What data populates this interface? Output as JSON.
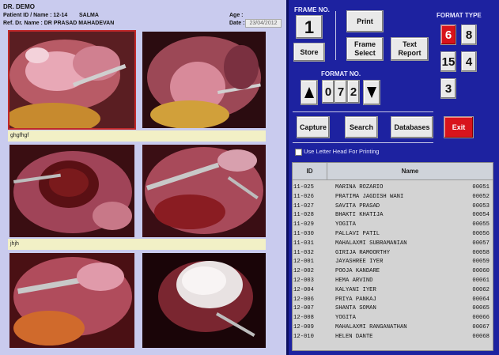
{
  "report": {
    "doctor": "DR. DEMO",
    "patient_label": "Patient ID / Name : 12-14",
    "patient_name": "SALMA",
    "ref_label": "Ref. Dr. Name : DR PRASAD MAHADEVAN",
    "age_label": "Age :",
    "date_label": "Date :",
    "date_value": "23/04/2012",
    "captions": [
      "ghgfhgf",
      "jhjh"
    ]
  },
  "controls": {
    "frame_no_label": "FRAME NO.",
    "frame_no": "1",
    "store": "Store",
    "print": "Print",
    "frame_select": "Frame Select",
    "text_report": "Text Report",
    "format_no_label": "FORMAT  NO.",
    "format_digits": [
      "0",
      "7",
      "2"
    ],
    "format_type_label": "FORMAT  TYPE",
    "format_types": [
      "6",
      "8",
      "15",
      "4",
      "3"
    ],
    "capture": "Capture",
    "search": "Search",
    "databases": "Databases",
    "exit": "Exit",
    "letterhead": "Use Letter Head For Printing",
    "accent_red": "#d8141c",
    "panel_blue": "#1d22a0"
  },
  "table": {
    "columns": [
      "ID",
      "Name"
    ],
    "rows": [
      {
        "id": "11-025",
        "name": "MARINA ROZARIO",
        "num": "00051"
      },
      {
        "id": "11-026",
        "name": "PRATIMA JAGDISH WANI",
        "num": "00052"
      },
      {
        "id": "11-027",
        "name": "SAVITA PRASAD",
        "num": "00053"
      },
      {
        "id": "11-028",
        "name": "BHAKTI KHATIJA",
        "num": "00054"
      },
      {
        "id": "11-029",
        "name": "YOGITA",
        "num": "00055"
      },
      {
        "id": "11-030",
        "name": "PALLAVI PATIL",
        "num": "00056"
      },
      {
        "id": "11-031",
        "name": "MAHALAXMI SUBRAMANIAN",
        "num": "00057"
      },
      {
        "id": "11-032",
        "name": "GIRIJA RAMOORTHY",
        "num": "00058"
      },
      {
        "id": "12-001",
        "name": "JAYASHREE IYER",
        "num": "00059"
      },
      {
        "id": "12-002",
        "name": "POOJA KANDARE",
        "num": "00060"
      },
      {
        "id": "12-003",
        "name": "HEMA ARVIND",
        "num": "00061"
      },
      {
        "id": "12-004",
        "name": "KALYANI IYER",
        "num": "00062"
      },
      {
        "id": "12-006",
        "name": "PRIYA PANKAJ",
        "num": "00064"
      },
      {
        "id": "12-007",
        "name": "SHANTA SOMAN",
        "num": "00065"
      },
      {
        "id": "12-008",
        "name": "YOGITA",
        "num": "00066"
      },
      {
        "id": "12-009",
        "name": "MAHALAXMI RANGANATHAN",
        "num": "00067"
      },
      {
        "id": "12-010",
        "name": "HELEN DANTE",
        "num": "00068"
      }
    ]
  }
}
